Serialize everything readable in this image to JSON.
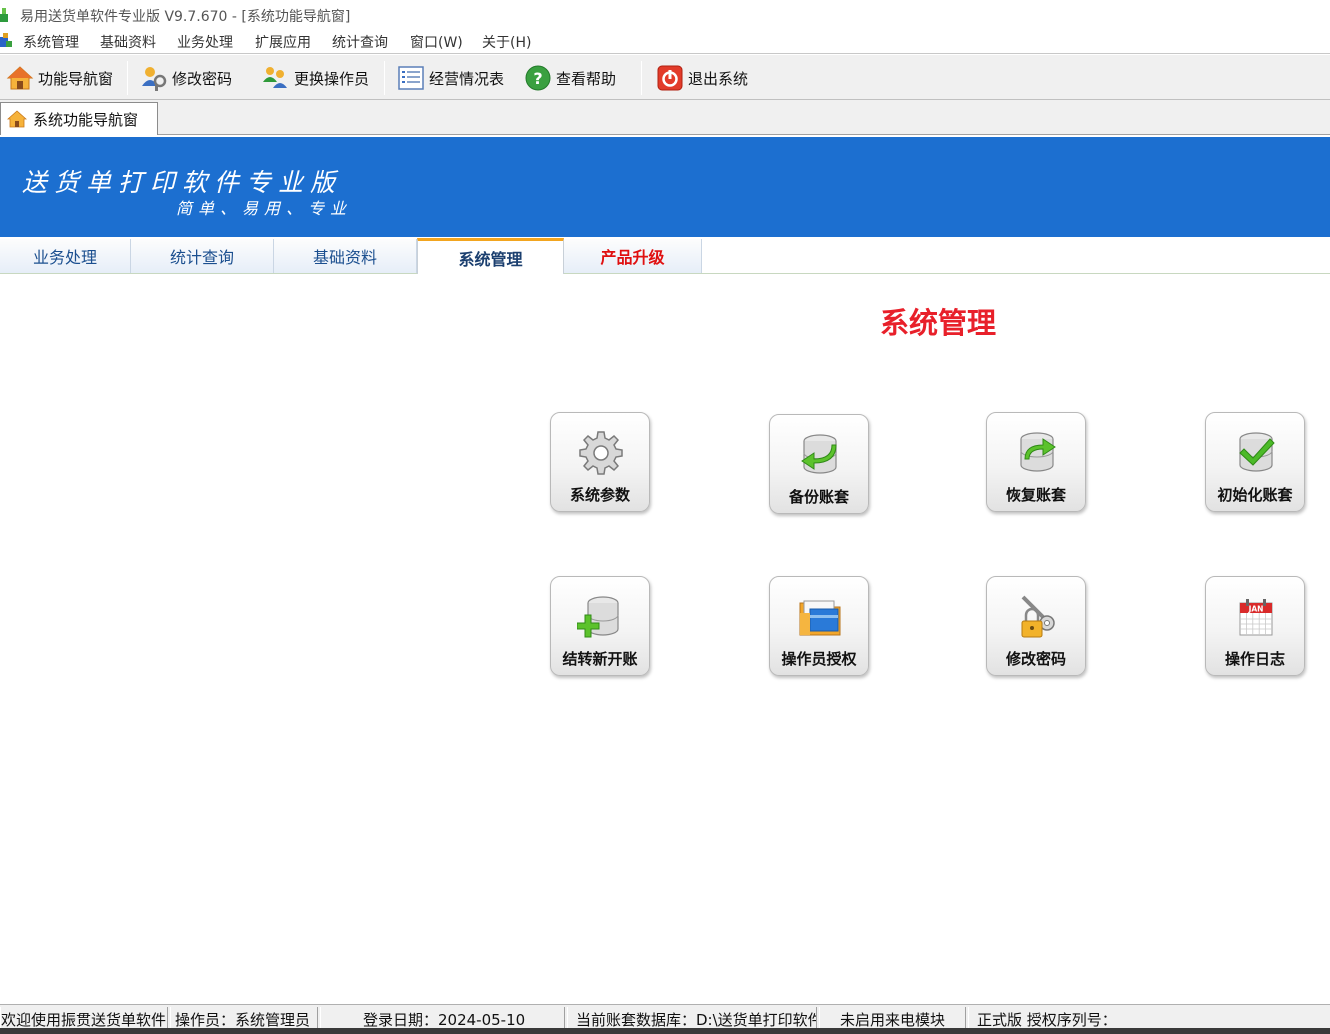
{
  "window": {
    "title": "易用送货单软件专业版 V9.7.670 - [系统功能导航窗]"
  },
  "menu": {
    "items": [
      "系统管理",
      "基础资料",
      "业务处理",
      "扩展应用",
      "统计查询",
      "窗口(W)",
      "关于(H)"
    ]
  },
  "toolbar": {
    "nav": "功能导航窗",
    "password": "修改密码",
    "switch_operator": "更换操作员",
    "report": "经营情况表",
    "help": "查看帮助",
    "exit": "退出系统"
  },
  "doc_tab": {
    "label": "系统功能导航窗"
  },
  "banner": {
    "line1": "送货单打印软件专业版",
    "line2": "简单、易用、专业"
  },
  "nav_tabs": [
    "业务处理",
    "统计查询",
    "基础资料",
    "系统管理",
    "产品升级"
  ],
  "active_tab": "系统管理",
  "main": {
    "section_title": "系统管理",
    "tiles": [
      {
        "label": "系统参数",
        "icon": "gear-icon"
      },
      {
        "label": "备份账套",
        "icon": "database-backup-icon"
      },
      {
        "label": "恢复账套",
        "icon": "database-restore-icon"
      },
      {
        "label": "初始化账套",
        "icon": "database-init-icon"
      },
      {
        "label": "结转新开账",
        "icon": "database-add-icon"
      },
      {
        "label": "操作员授权",
        "icon": "folder-permission-icon"
      },
      {
        "label": "修改密码",
        "icon": "lock-key-icon"
      },
      {
        "label": "操作日志",
        "icon": "calendar-icon"
      }
    ],
    "calendar_month": "JAN"
  },
  "statusbar": {
    "welcome": "欢迎使用振贯送货单软件",
    "operator": "操作员：系统管理员",
    "login_date": "登录日期：2024-05-10",
    "database": "当前账套数据库：D:\\送货单打印软件",
    "caller_module": "未启用来电模块",
    "license": "正式版  授权序列号："
  },
  "colors": {
    "banner": "#1c6fd0",
    "section_title": "#e8202a",
    "active_tab_border": "#f2a51f",
    "upgrade_tab": "#e01010"
  }
}
